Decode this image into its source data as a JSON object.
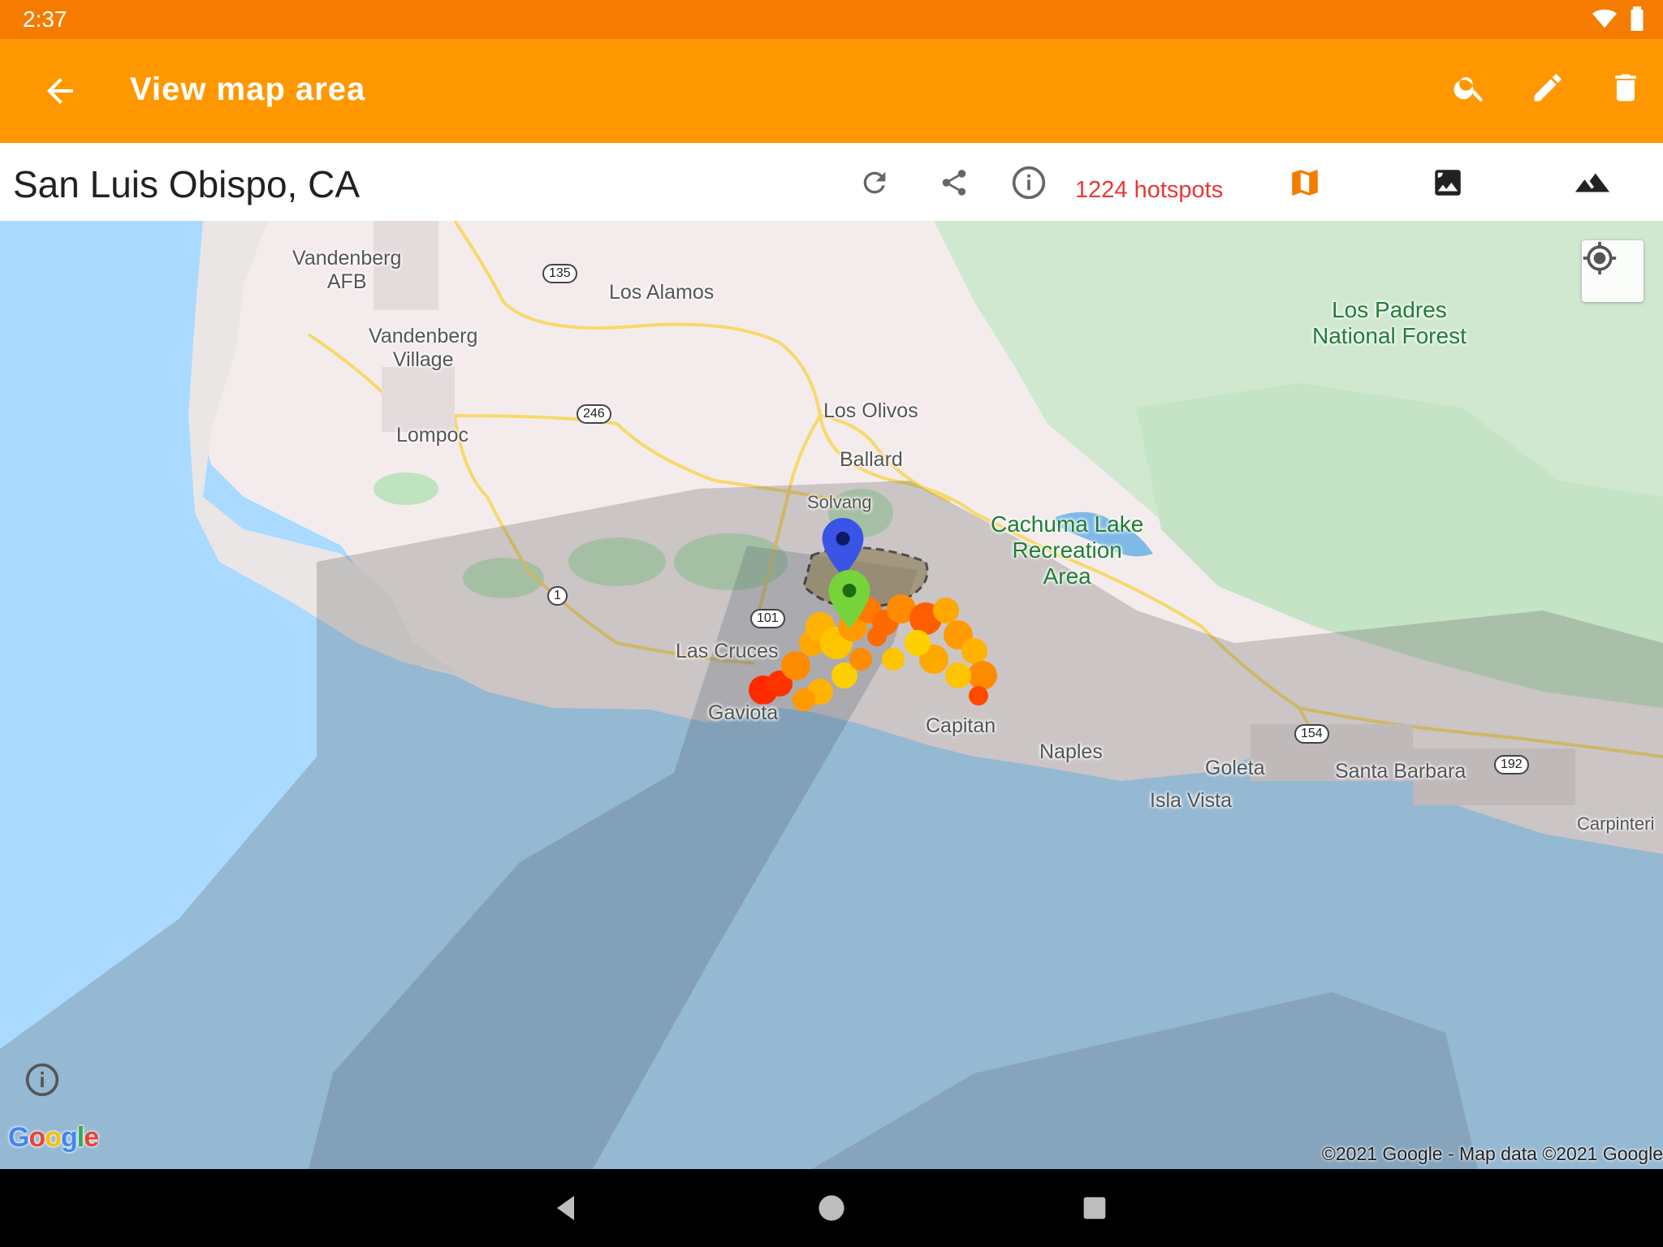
{
  "status": {
    "time": "2:37"
  },
  "app_bar": {
    "title": "View map area",
    "icons": [
      "arrow-back-icon",
      "search-icon",
      "edit-icon",
      "delete-icon"
    ]
  },
  "toolbar": {
    "location": "San Luis Obispo, CA",
    "hotspots": "1224 hotspots",
    "icons": [
      "refresh-icon",
      "share-icon",
      "info-icon",
      "map-icon",
      "satellite-icon",
      "terrain-icon"
    ],
    "active_color": "#f57c00"
  },
  "map": {
    "places": {
      "vandenberg_afb": "Vandenberg\nAFB",
      "los_alamos": "Los Alamos",
      "vandenberg_village": "Vandenberg\nVillage",
      "lompoc": "Lompoc",
      "los_olivos": "Los Olivos",
      "ballard": "Ballard",
      "solvang": "Solvang",
      "las_cruces": "Las Cruces",
      "gaviota": "Gaviota",
      "capitan": "Capitan",
      "naples": "Naples",
      "goleta": "Goleta",
      "isla_vista": "Isla Vista",
      "santa_barbara": "Santa Barbara",
      "carpinteria": "Carpinteri"
    },
    "parks": {
      "los_padres": "Los Padres\nNational Forest",
      "cachuma": "Cachuma Lake\nRecreation\nArea"
    },
    "highways": [
      "135",
      "246",
      "1",
      "101",
      "154",
      "192"
    ],
    "google": "Google",
    "copyright": "©2021 Google - Map data ©2021 Google"
  }
}
